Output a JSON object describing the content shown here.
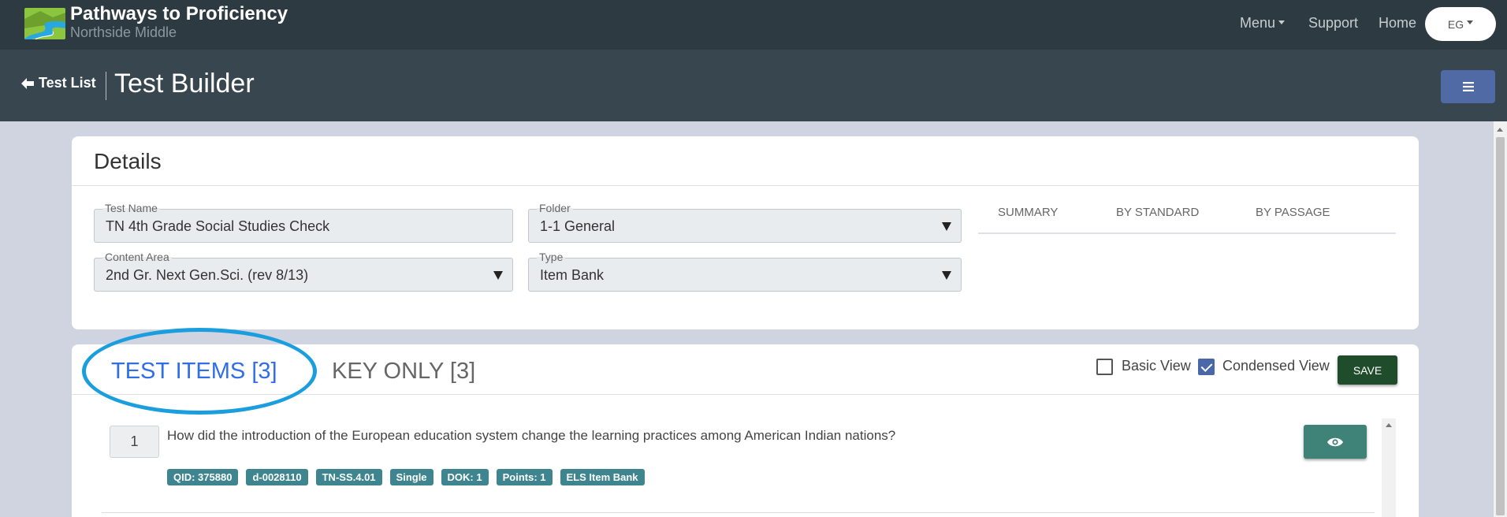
{
  "brand": {
    "title": "Pathways to Proficiency",
    "subtitle": "Northside Middle"
  },
  "nav": {
    "menu": "Menu",
    "support": "Support",
    "home": "Home",
    "user": "EG"
  },
  "subheader": {
    "back": "Test List",
    "title": "Test Builder"
  },
  "details": {
    "title": "Details",
    "test_name": {
      "label": "Test Name",
      "value": "TN 4th Grade Social Studies Check"
    },
    "folder": {
      "label": "Folder",
      "value": "1-1 General"
    },
    "content_area": {
      "label": "Content Area",
      "value": "2nd Gr. Next Gen.Sci. (rev 8/13)"
    },
    "type": {
      "label": "Type",
      "value": "Item Bank"
    },
    "summary_tabs": [
      "SUMMARY",
      "BY STANDARD",
      "BY PASSAGE"
    ]
  },
  "items": {
    "tabs": [
      "TEST ITEMS [3]",
      "KEY ONLY [3]"
    ],
    "active_tab": 0,
    "basic_view": {
      "label": "Basic View",
      "checked": false
    },
    "condensed_view": {
      "label": "Condensed View",
      "checked": true
    },
    "save": "SAVE",
    "questions": [
      {
        "number": "1",
        "text": "How did the introduction of the European education system change the learning practices among American Indian nations?",
        "tags": [
          "QID: 375880",
          "d-0028110",
          "TN-SS.4.01",
          "Single",
          "DOK: 1",
          "Points: 1",
          "ELS Item Bank"
        ]
      }
    ]
  },
  "icons": {
    "logo": "road-landscape-logo",
    "back": "arrow-left-icon",
    "menu": "hamburger-icon",
    "preview": "eye-icon"
  },
  "colors": {
    "topbar": "#2d3a42",
    "subheader": "#37464f",
    "accent_blue": "#2f6ee8",
    "tag_teal": "#3e8590",
    "save_green": "#1f4d2c",
    "highlight_ring": "#1b9ede"
  }
}
